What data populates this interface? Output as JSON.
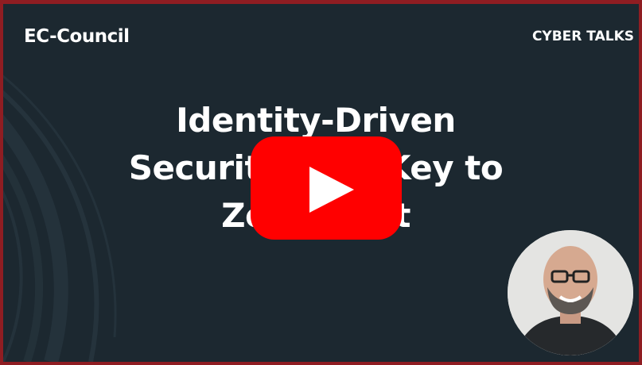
{
  "video": {
    "brand": "EC-Council",
    "series": "CYBER TALKS",
    "title_lines": [
      "Identity-Driven",
      "Security: The Key to",
      "Zero Trust"
    ]
  },
  "icons": {
    "play": "play-button-icon",
    "speaker": "speaker-photo"
  },
  "colors": {
    "background": "#1c2830",
    "border": "#8f1d22",
    "play_button": "#ff0000",
    "text": "#ffffff"
  }
}
